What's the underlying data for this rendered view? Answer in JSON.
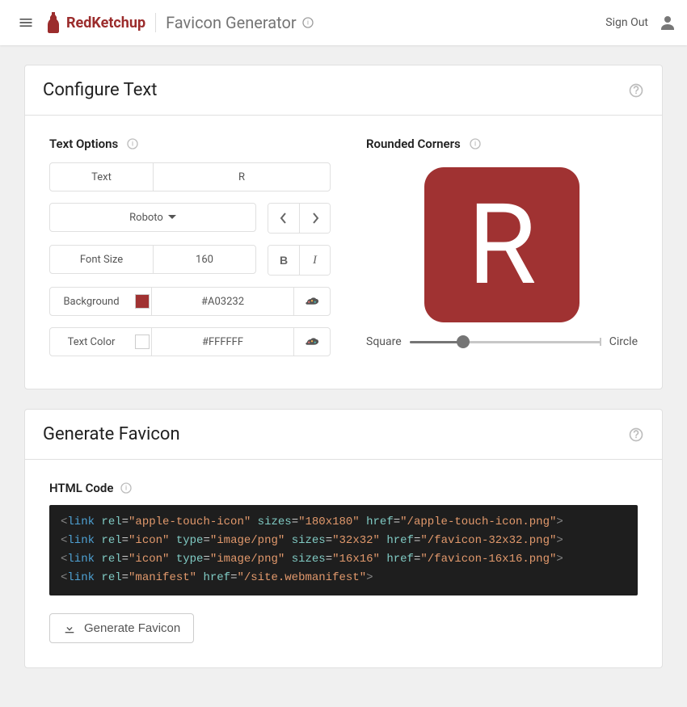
{
  "appbar": {
    "brand": "RedKetchup",
    "page_title": "Favicon Generator",
    "sign_out": "Sign Out"
  },
  "configure": {
    "card_title": "Configure Text",
    "text_options_label": "Text Options",
    "text_label": "Text",
    "text_value": "R",
    "font_name": "Roboto",
    "font_size_label": "Font Size",
    "font_size_value": "160",
    "background_label": "Background",
    "background_value": "#A03232",
    "text_color_label": "Text Color",
    "text_color_value": "#FFFFFF",
    "rounded_label": "Rounded Corners",
    "preview_letter": "R",
    "preview_bg": "#A03232",
    "slider_left": "Square",
    "slider_right": "Circle"
  },
  "generate": {
    "card_title": "Generate Favicon",
    "html_code_label": "HTML Code",
    "button_label": "Generate Favicon",
    "code_lines": [
      {
        "rel": "apple-touch-icon",
        "type": null,
        "sizes": "180x180",
        "href": "/apple-touch-icon.png"
      },
      {
        "rel": "icon",
        "type": "image/png",
        "sizes": "32x32",
        "href": "/favicon-32x32.png"
      },
      {
        "rel": "icon",
        "type": "image/png",
        "sizes": "16x16",
        "href": "/favicon-16x16.png"
      },
      {
        "rel": "manifest",
        "type": null,
        "sizes": null,
        "href": "/site.webmanifest"
      }
    ]
  }
}
